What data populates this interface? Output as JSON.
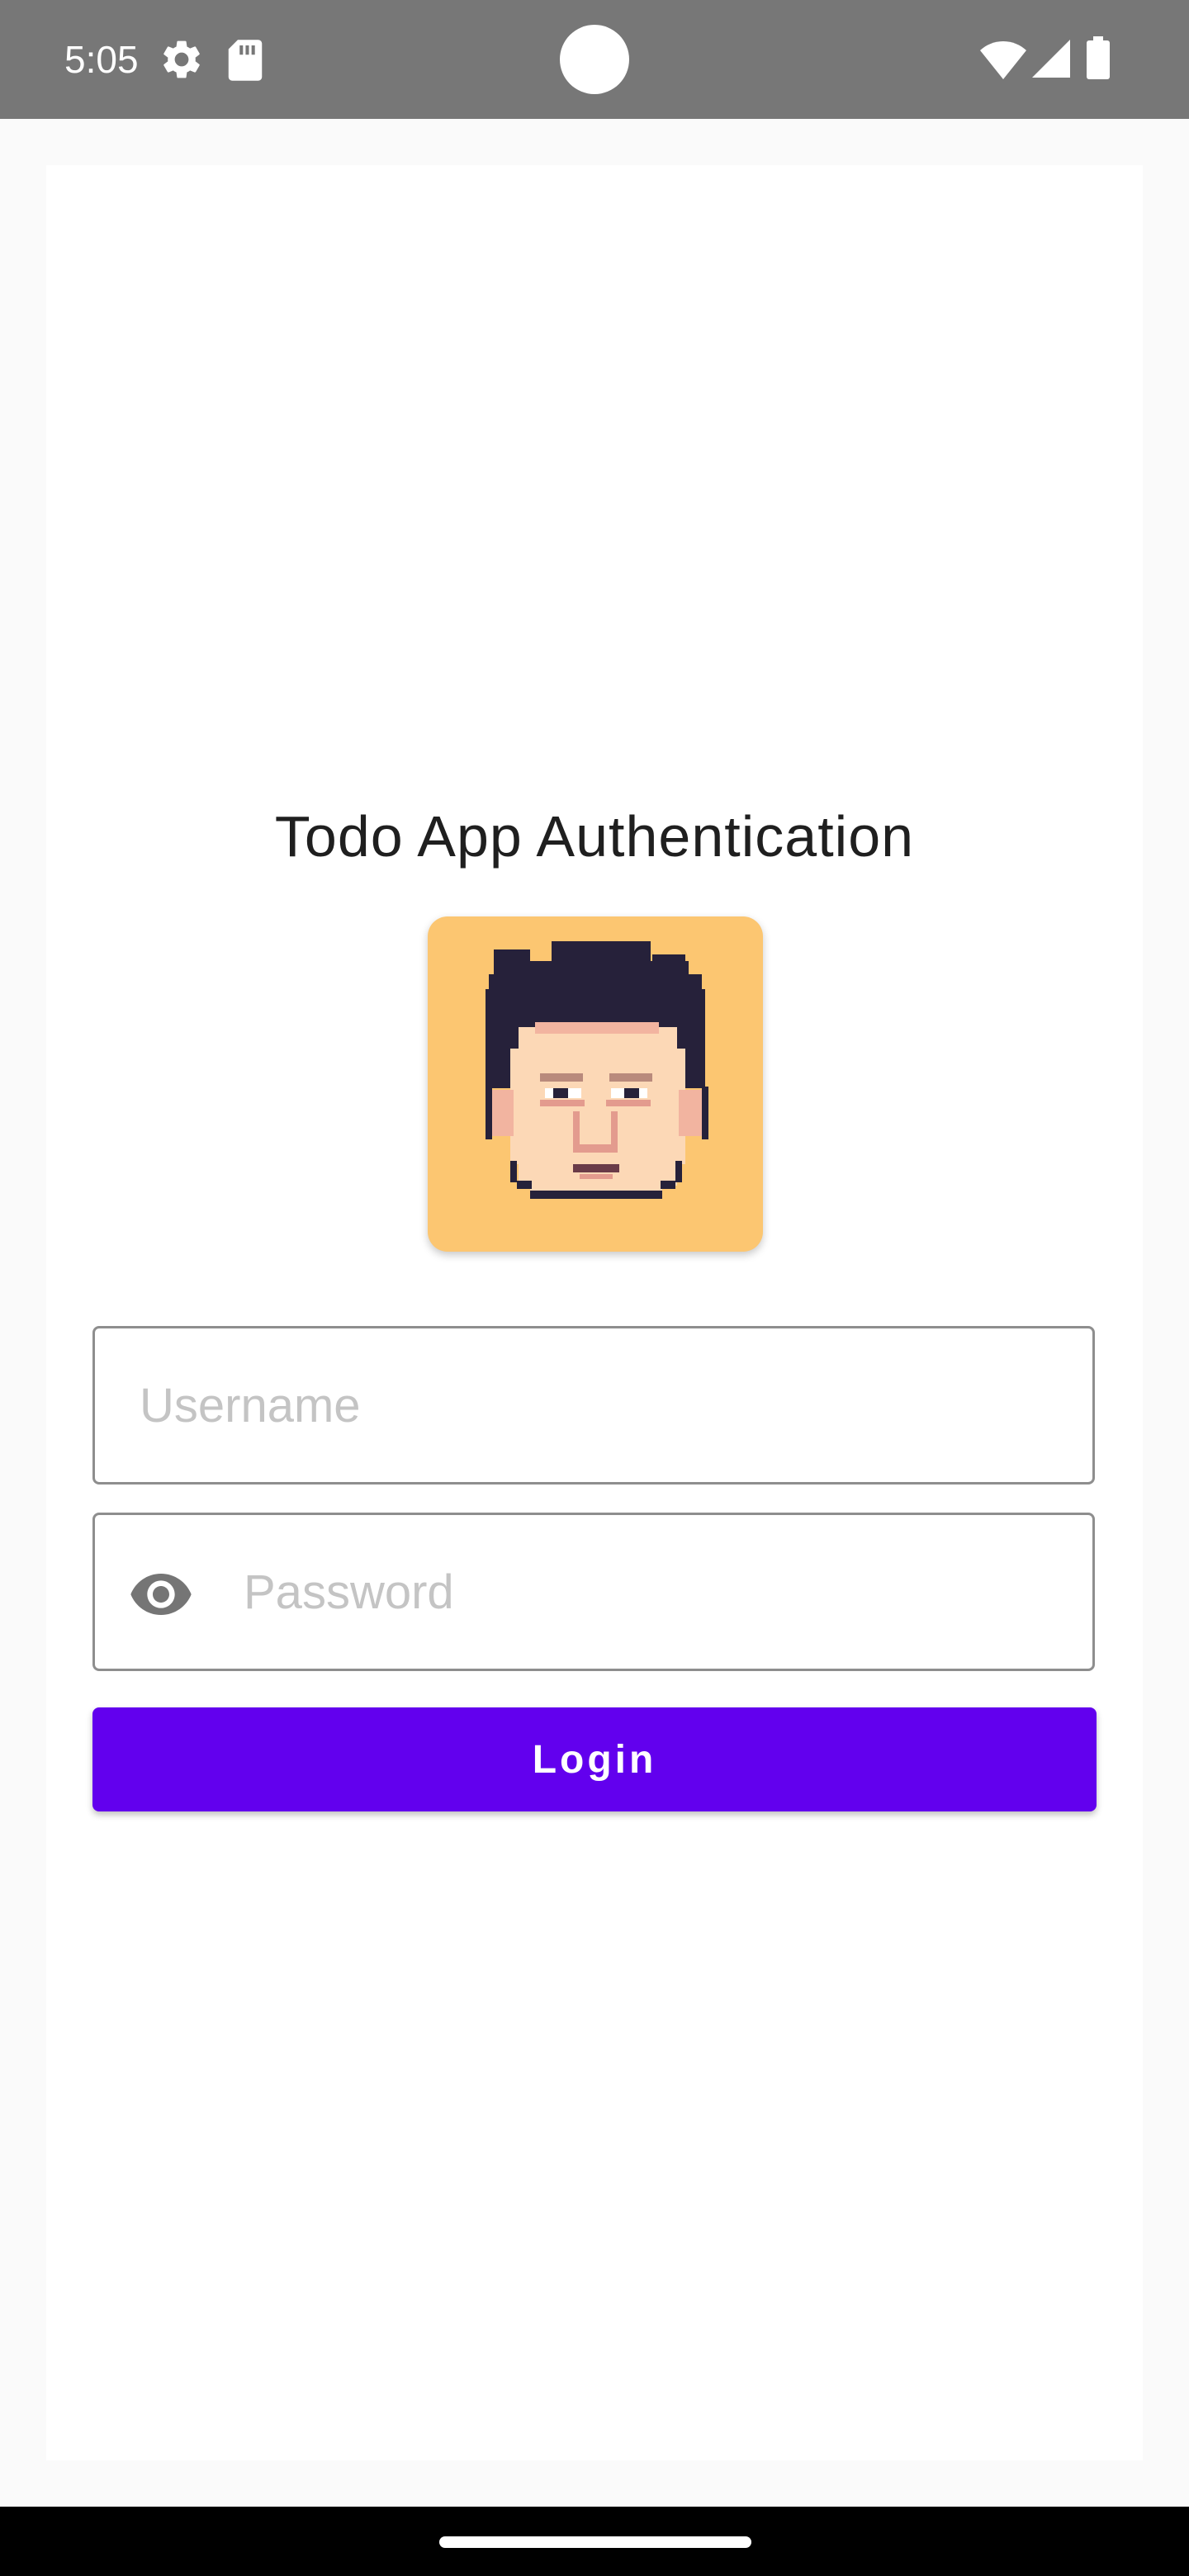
{
  "status_bar": {
    "time": "5:05",
    "left_icons": [
      "settings-gear-icon",
      "sd-card-icon"
    ],
    "right_icons": [
      "wifi-icon",
      "cellular-signal-icon",
      "battery-icon"
    ]
  },
  "login": {
    "title": "Todo App Authentication",
    "avatar": "pixel-art-face-avatar",
    "username_placeholder": "Username",
    "username_value": "",
    "password_placeholder": "Password",
    "password_value": "",
    "password_toggle_icon": "eye-icon",
    "login_label": "Login"
  },
  "colors": {
    "status_bar": "#777777",
    "primary_button": "#6200ee",
    "avatar_background": "#fcc671",
    "field_border": "#8e8e8e",
    "placeholder_text": "#c4c4c4",
    "title_text": "#1f1f1f"
  }
}
